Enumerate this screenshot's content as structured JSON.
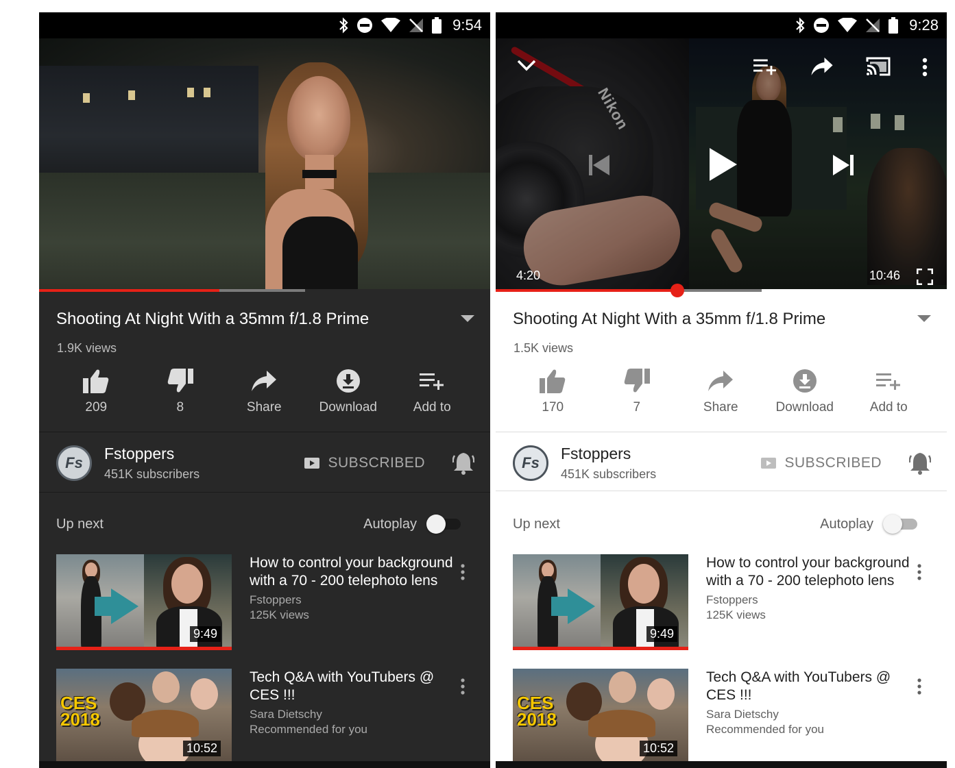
{
  "left": {
    "status_time": "9:54",
    "video": {
      "title": "Shooting At Night With a 35mm f/1.8 Prime",
      "views": "1.9K views",
      "progress_fraction": 0.4,
      "buffer_fraction": 0.59
    },
    "actions": [
      {
        "label": "209",
        "icon": "thumbs-up-icon"
      },
      {
        "label": "8",
        "icon": "thumbs-down-icon"
      },
      {
        "label": "Share",
        "icon": "share-icon"
      },
      {
        "label": "Download",
        "icon": "download-icon"
      },
      {
        "label": "Add to",
        "icon": "add-to-playlist-icon"
      }
    ],
    "channel": {
      "avatar_text": "Fs",
      "name": "Fstoppers",
      "subscribers": "451K subscribers",
      "subscribe_label": "SUBSCRIBED"
    },
    "up_next_label": "Up next",
    "autoplay_label": "Autoplay",
    "items": [
      {
        "title": "How to control your background with a 70 - 200 telephoto lens",
        "channel": "Fstoppers",
        "views": "125K views",
        "duration": "9:49"
      },
      {
        "title": "Tech Q&A with YouTubers @ CES !!!",
        "channel": "Sara Dietschy",
        "views": "Recommended for you",
        "duration": "10:52",
        "thumb_text_1": "CES",
        "thumb_text_2": "2018"
      }
    ]
  },
  "right": {
    "status_time": "9:28",
    "player": {
      "current_time": "4:20",
      "total_time": "10:46",
      "progress_fraction": 0.402,
      "buffer_fraction": 0.59,
      "camera_brand": "Nikon"
    },
    "video": {
      "title": "Shooting At Night With a 35mm f/1.8 Prime",
      "views": "1.5K views"
    },
    "actions": [
      {
        "label": "170",
        "icon": "thumbs-up-icon"
      },
      {
        "label": "7",
        "icon": "thumbs-down-icon"
      },
      {
        "label": "Share",
        "icon": "share-icon"
      },
      {
        "label": "Download",
        "icon": "download-icon"
      },
      {
        "label": "Add to",
        "icon": "add-to-playlist-icon"
      }
    ],
    "channel": {
      "avatar_text": "Fs",
      "name": "Fstoppers",
      "subscribers": "451K subscribers",
      "subscribe_label": "SUBSCRIBED"
    },
    "up_next_label": "Up next",
    "autoplay_label": "Autoplay",
    "items": [
      {
        "title": "How to control your background with a 70 - 200 telephoto lens",
        "channel": "Fstoppers",
        "views": "125K views",
        "duration": "9:49"
      },
      {
        "title": "Tech Q&A with YouTubers @ CES !!!",
        "channel": "Sara Dietschy",
        "views": "Recommended for you",
        "duration": "10:52",
        "thumb_text_1": "CES",
        "thumb_text_2": "2018"
      }
    ]
  },
  "colors": {
    "accent_red": "#e62117",
    "dark_background": "#282828",
    "light_background": "#ffffff",
    "dark_secondary_text": "#aaaaaa",
    "light_secondary_text": "#606060"
  }
}
